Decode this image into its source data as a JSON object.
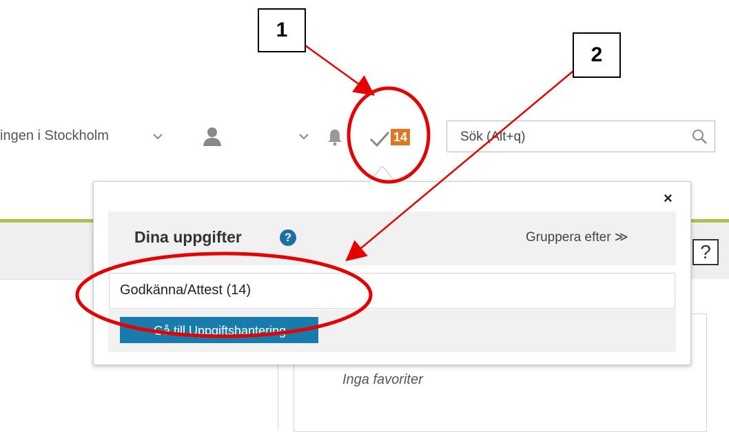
{
  "topbar": {
    "org_name": "ingen i Stockholm",
    "tasks_badge": "14",
    "search_placeholder": "Sök (Alt+q)"
  },
  "popup": {
    "title": "Dina uppgifter",
    "help": "?",
    "group_by": "Gruppera efter ≫",
    "close": "×",
    "task_row": "Godkänna/Attest (14)",
    "go_button": "Gå till Uppgiftshantering"
  },
  "page": {
    "help": "?",
    "favorites_empty": "Inga favoriter"
  },
  "annotations": {
    "callout_1": "1",
    "callout_2": "2"
  },
  "colors": {
    "accent_green": "#a8c64a",
    "badge_orange": "#e07722",
    "button_blue": "#177bab",
    "annotation_red": "#e60000"
  }
}
